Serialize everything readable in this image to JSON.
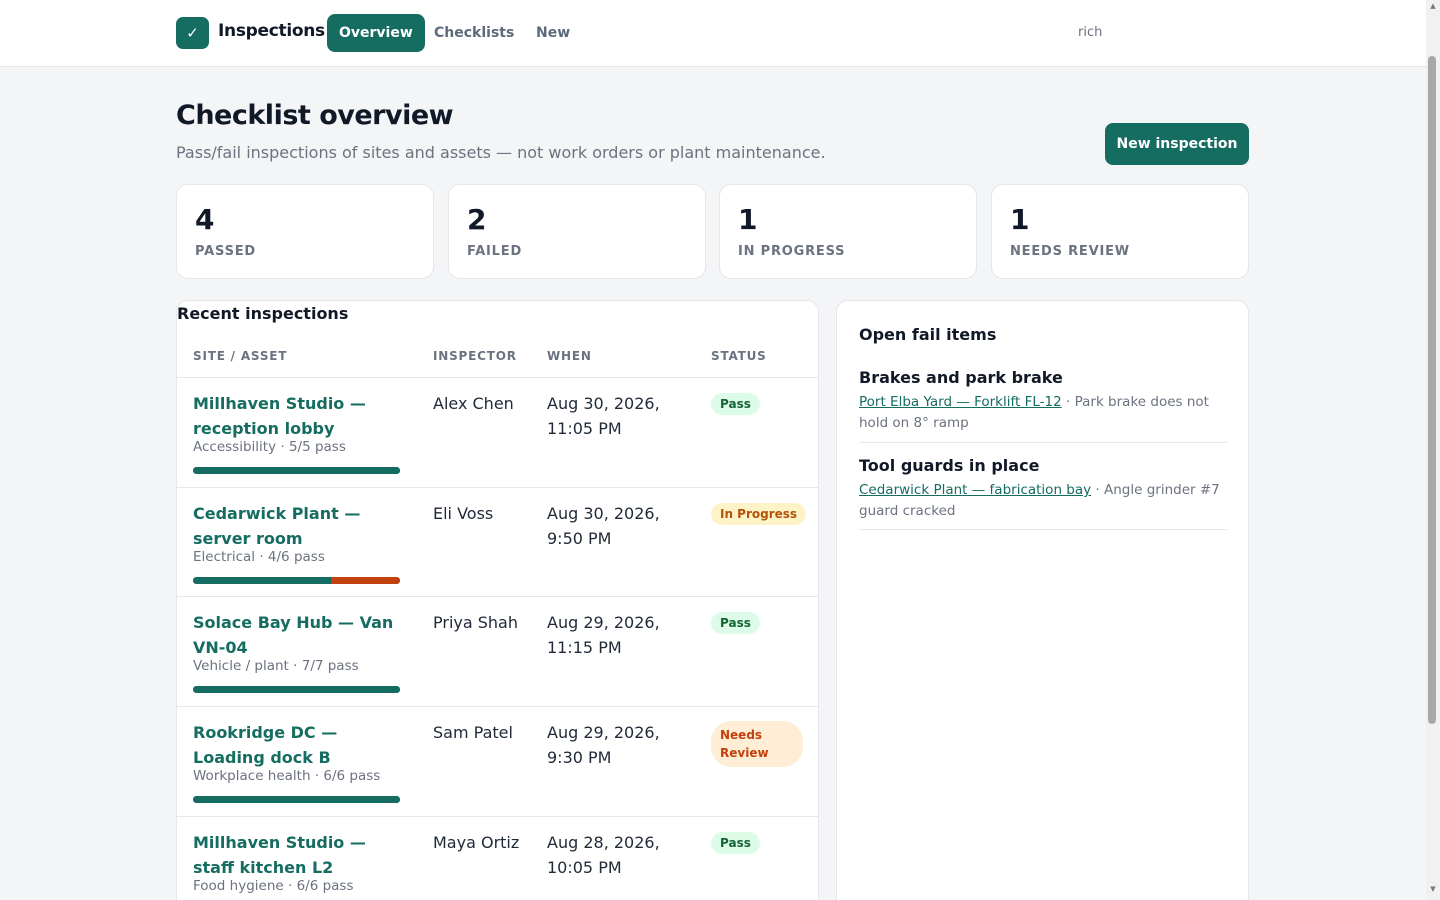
{
  "app": {
    "badge_glyph": "✓",
    "name": "Inspections"
  },
  "nav": {
    "tabs": [
      "Overview",
      "Checklists",
      "New"
    ],
    "active": "Overview"
  },
  "user": {
    "name": "rich"
  },
  "page": {
    "title": "Checklist overview",
    "subtitle": "Pass/fail inspections of sites and assets — not work orders or plant maintenance.",
    "new_button": "New inspection"
  },
  "stats": [
    {
      "value": "4",
      "label": "PASSED"
    },
    {
      "value": "2",
      "label": "FAILED"
    },
    {
      "value": "1",
      "label": "IN PROGRESS"
    },
    {
      "value": "1",
      "label": "NEEDS REVIEW"
    }
  ],
  "recent": {
    "title": "Recent inspections",
    "columns": [
      "SITE / ASSET",
      "INSPECTOR",
      "WHEN",
      "STATUS"
    ],
    "rows": [
      {
        "site": "Millhaven Studio — reception lobby",
        "meta": "Accessibility · 5/5 pass",
        "pass_fraction": 1.0,
        "inspector": "Alex Chen",
        "when": "Aug 30, 2026, 11:05 PM",
        "status": "Pass",
        "status_kind": "pass"
      },
      {
        "site": "Cedarwick Plant — server room",
        "meta": "Electrical · 4/6 pass",
        "pass_fraction": 0.6667,
        "inspector": "Eli Voss",
        "when": "Aug 30, 2026, 9:50 PM",
        "status": "In Progress",
        "status_kind": "progress"
      },
      {
        "site": "Solace Bay Hub — Van VN-04",
        "meta": "Vehicle / plant · 7/7 pass",
        "pass_fraction": 1.0,
        "inspector": "Priya Shah",
        "when": "Aug 29, 2026, 11:15 PM",
        "status": "Pass",
        "status_kind": "pass"
      },
      {
        "site": "Rookridge DC — Loading dock B",
        "meta": "Workplace health · 6/6 pass",
        "pass_fraction": 1.0,
        "inspector": "Sam Patel",
        "when": "Aug 29, 2026, 9:30 PM",
        "status": "Needs Review",
        "status_kind": "review"
      },
      {
        "site": "Millhaven Studio — staff kitchen L2",
        "meta": "Food hygiene · 6/6 pass",
        "pass_fraction": 1.0,
        "inspector": "Maya Ortiz",
        "when": "Aug 28, 2026, 10:05 PM",
        "status": "Pass",
        "status_kind": "pass"
      }
    ]
  },
  "open_fails": {
    "title": "Open fail items",
    "items": [
      {
        "title": "Brakes and park brake",
        "link": "Port Elba Yard — Forklift FL-12",
        "detail": " · Park brake does not hold on 8° ramp"
      },
      {
        "title": "Tool guards in place",
        "link": "Cedarwick Plant — fabrication bay",
        "detail": " · Angle grinder #7 guard cracked"
      }
    ]
  },
  "colors": {
    "accent": "#156c61",
    "fail": "#c2410c",
    "pass_badge_bg": "#dcfce7",
    "progress_badge_bg": "#fef3c7",
    "review_badge_bg": "#ffedd5"
  }
}
